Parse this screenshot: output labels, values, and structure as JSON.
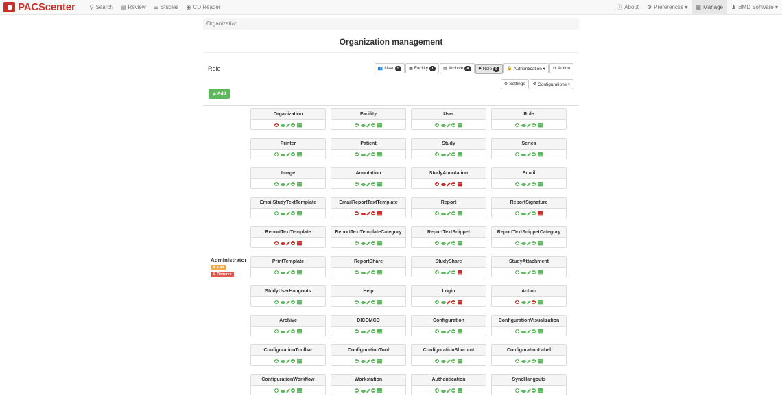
{
  "navbar": {
    "brand": "PACScenter",
    "items": [
      {
        "label": "Search",
        "icon": "search-icon"
      },
      {
        "label": "Review",
        "icon": "file-icon"
      },
      {
        "label": "Studies",
        "icon": "list-icon"
      },
      {
        "label": "CD Reader",
        "icon": "cd-icon"
      }
    ],
    "right": [
      {
        "label": "About",
        "icon": "info-icon"
      },
      {
        "label": "Preferences ▾",
        "icon": "gears-icon"
      },
      {
        "label": "Manage",
        "icon": "table-icon"
      },
      {
        "label": "BMD Software ▾",
        "icon": "user-icon"
      }
    ]
  },
  "breadcrumb": "Organization",
  "page_title": "Organization management",
  "section_label": "Role",
  "buttons": [
    {
      "label": "User",
      "badge": "5",
      "icon": "users-icon",
      "active": false
    },
    {
      "label": "Facility",
      "badge": "1",
      "icon": "building-icon",
      "active": false
    },
    {
      "label": "Archive",
      "badge": "4",
      "icon": "archive-icon",
      "active": false
    },
    {
      "label": "Role",
      "badge": "5",
      "icon": "tag-icon",
      "active": true
    },
    {
      "label": "Authentication ▾",
      "badge": "",
      "icon": "lock-icon",
      "active": false
    },
    {
      "label": "Action",
      "badge": "",
      "icon": "undo-icon",
      "active": false
    },
    {
      "label": "Settings",
      "badge": "",
      "icon": "gear-icon",
      "active": false
    },
    {
      "label": "Configurations ▾",
      "badge": "",
      "icon": "gear-icon",
      "active": false
    }
  ],
  "add_label": "Add",
  "role": {
    "name": "Administrator",
    "edit_label": "Edit",
    "remove_label": "Remove"
  },
  "permission_colors": {
    "allowed": "#5cb85c",
    "denied": "#c9302c"
  },
  "permissions": [
    {
      "name": "Organization",
      "perms": [
        "r",
        "g",
        "g",
        "g",
        "g"
      ]
    },
    {
      "name": "Facility",
      "perms": [
        "g",
        "g",
        "g",
        "g",
        "g"
      ]
    },
    {
      "name": "User",
      "perms": [
        "g",
        "g",
        "g",
        "g",
        "g"
      ]
    },
    {
      "name": "Role",
      "perms": [
        "g",
        "g",
        "g",
        "g",
        "g"
      ]
    },
    {
      "name": "Printer",
      "perms": [
        "g",
        "g",
        "g",
        "g",
        "g"
      ]
    },
    {
      "name": "Patient",
      "perms": [
        "g",
        "g",
        "g",
        "g",
        "g"
      ]
    },
    {
      "name": "Study",
      "perms": [
        "g",
        "g",
        "g",
        "g",
        "g"
      ]
    },
    {
      "name": "Series",
      "perms": [
        "g",
        "g",
        "g",
        "g",
        "g"
      ]
    },
    {
      "name": "Image",
      "perms": [
        "g",
        "g",
        "g",
        "g",
        "g"
      ]
    },
    {
      "name": "Annotation",
      "perms": [
        "g",
        "g",
        "g",
        "g",
        "g"
      ]
    },
    {
      "name": "StudyAnnotation",
      "perms": [
        "r",
        "r",
        "r",
        "r",
        "r"
      ]
    },
    {
      "name": "Email",
      "perms": [
        "g",
        "g",
        "g",
        "g",
        "g"
      ]
    },
    {
      "name": "EmailStudyTextTemplate",
      "perms": [
        "g",
        "g",
        "g",
        "g",
        "g"
      ]
    },
    {
      "name": "EmailReportTextTemplate",
      "perms": [
        "r",
        "r",
        "r",
        "r",
        "r"
      ]
    },
    {
      "name": "Report",
      "perms": [
        "g",
        "g",
        "g",
        "g",
        "g"
      ]
    },
    {
      "name": "ReportSignature",
      "perms": [
        "g",
        "g",
        "g",
        "g",
        "r"
      ]
    },
    {
      "name": "ReportTextTemplate",
      "perms": [
        "r",
        "r",
        "r",
        "r",
        "r"
      ]
    },
    {
      "name": "ReportTextTemplateCategory",
      "perms": [
        "g",
        "g",
        "g",
        "g",
        "g"
      ]
    },
    {
      "name": "ReportTextSnippet",
      "perms": [
        "g",
        "g",
        "g",
        "g",
        "g"
      ]
    },
    {
      "name": "ReportTextSnippetCategory",
      "perms": [
        "g",
        "g",
        "g",
        "g",
        "g"
      ]
    },
    {
      "name": "PrintTemplate",
      "perms": [
        "g",
        "g",
        "g",
        "g",
        "g"
      ]
    },
    {
      "name": "ReportShare",
      "perms": [
        "g",
        "g",
        "g",
        "g",
        "g"
      ]
    },
    {
      "name": "StudyShare",
      "perms": [
        "g",
        "g",
        "g",
        "g",
        "r"
      ]
    },
    {
      "name": "StudyAttachment",
      "perms": [
        "g",
        "g",
        "g",
        "g",
        "g"
      ]
    },
    {
      "name": "StudyUserHangouts",
      "perms": [
        "g",
        "g",
        "g",
        "g",
        "g"
      ]
    },
    {
      "name": "Help",
      "perms": [
        "g",
        "g",
        "g",
        "g",
        "g"
      ]
    },
    {
      "name": "Login",
      "perms": [
        "g",
        "g",
        "r",
        "r",
        "r"
      ]
    },
    {
      "name": "Action",
      "perms": [
        "r",
        "g",
        "g",
        "r",
        "g"
      ]
    },
    {
      "name": "Archive",
      "perms": [
        "g",
        "g",
        "g",
        "g",
        "g"
      ]
    },
    {
      "name": "DICOMCD",
      "perms": [
        "g",
        "g",
        "g",
        "g",
        "g"
      ]
    },
    {
      "name": "Configuration",
      "perms": [
        "g",
        "g",
        "g",
        "g",
        "g"
      ]
    },
    {
      "name": "ConfigurationVisualization",
      "perms": [
        "g",
        "g",
        "g",
        "g",
        "g"
      ]
    },
    {
      "name": "ConfigurationToolbar",
      "perms": [
        "g",
        "g",
        "g",
        "g",
        "g"
      ]
    },
    {
      "name": "ConfigurationTool",
      "perms": [
        "g",
        "g",
        "g",
        "g",
        "g"
      ]
    },
    {
      "name": "ConfigurationShortcut",
      "perms": [
        "g",
        "g",
        "g",
        "g",
        "g"
      ]
    },
    {
      "name": "ConfigurationLabel",
      "perms": [
        "g",
        "g",
        "g",
        "g",
        "g"
      ]
    },
    {
      "name": "ConfigurationWorkflow",
      "perms": [
        "g",
        "g",
        "g",
        "g",
        "g"
      ]
    },
    {
      "name": "Workstation",
      "perms": [
        "g",
        "g",
        "g",
        "g",
        "g"
      ]
    },
    {
      "name": "Authentication",
      "perms": [
        "g",
        "g",
        "g",
        "g",
        "g"
      ]
    },
    {
      "name": "SyncHangouts",
      "perms": [
        "g",
        "g",
        "g",
        "g",
        "g"
      ]
    }
  ]
}
